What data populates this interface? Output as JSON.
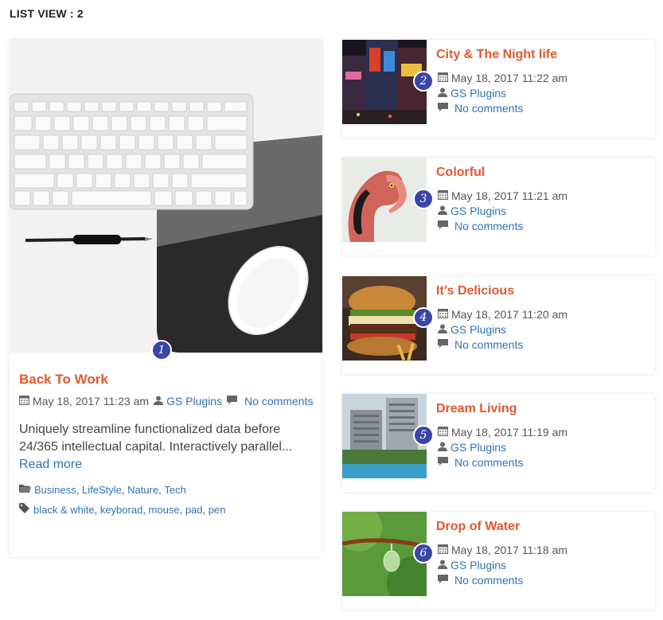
{
  "heading": "LIST VIEW : 2",
  "featured": {
    "badge": "1",
    "title": "Back To Work",
    "date": "May 18, 2017 11:23 am",
    "author": "GS Plugins",
    "comments": "No comments",
    "excerpt": "Uniquely streamline functionalized data before 24/365 intellectual capital. Interactively parallel...",
    "read_more": "Read more",
    "categories": [
      "Business",
      "LifeStyle",
      "Nature",
      "Tech"
    ],
    "tags": [
      "black & white",
      "keyborad",
      "mouse",
      "pad",
      "pen"
    ],
    "icons": {
      "date": "calendar-icon",
      "author": "user-icon",
      "comments": "comment-icon",
      "categories": "folder-icon",
      "tags": "tag-icon"
    }
  },
  "items": [
    {
      "badge": "2",
      "title": "City & The Night life",
      "date": "May 18, 2017 11:22 am",
      "author": "GS Plugins",
      "comments": "No comments"
    },
    {
      "badge": "3",
      "title": "Colorful",
      "date": "May 18, 2017 11:21 am",
      "author": "GS Plugins",
      "comments": "No comments"
    },
    {
      "badge": "4",
      "title": "It’s Delicious",
      "date": "May 18, 2017 11:20 am",
      "author": "GS Plugins",
      "comments": "No comments"
    },
    {
      "badge": "5",
      "title": "Dream Living",
      "date": "May 18, 2017 11:19 am",
      "author": "GS Plugins",
      "comments": "No comments"
    },
    {
      "badge": "6",
      "title": "Drop of Water",
      "date": "May 18, 2017 11:18 am",
      "author": "GS Plugins",
      "comments": "No comments"
    }
  ],
  "colors": {
    "title": "#e2572f",
    "link": "#2f73b4",
    "badge": "#3a45a8"
  }
}
